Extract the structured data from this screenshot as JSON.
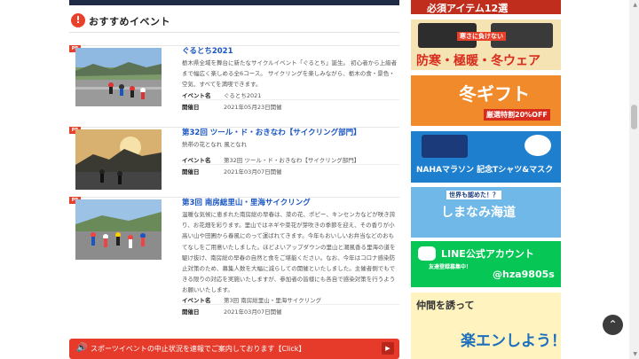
{
  "section": {
    "icon": "!",
    "title": "おすすめイベント"
  },
  "events": [
    {
      "badge": "PR",
      "title": "ぐるとち2021",
      "desc": "栃木県全域を舞台に新たなサイクルイベント「ぐるとち」誕生。 初心者から上級者まで幅広く楽しめる全6コース。 サイクリングを楽しみながら、栃木の食・景色・空気、すべてを満喫できます。",
      "event_label": "イベント名",
      "event_name": "ぐるとち2021",
      "date_label": "開催日",
      "date": "2021年05月23日開催"
    },
    {
      "badge": "PR",
      "title": "第32回 ツール・ド・おきなわ【サイクリング部門】",
      "desc": "熱帯の花となれ 風となれ",
      "event_label": "イベント名",
      "event_name": "第32回 ツール・ド・おきなわ【サイクリング部門】",
      "date_label": "開催日",
      "date": "2021年03月07日開催"
    },
    {
      "badge": "PR",
      "title": "第3回 南房総里山・里海サイクリング",
      "desc": "温暖な気候に恵まれた南房総の早春は、菜の花、ポピー、キンセンカなどが咲き誇り、お花畑を彩ります。里山ではネギや菜花が芽吹きの季節を迎え、その香りが小高い山や田圃から春風にのって運ばれてきます。今年もおいしいお弁当などのおもてなしをご用意いたしました。ほどよいアップダウンの里山と潮風香る里海の道を駆け抜け、南房総の早春の自然と食をご堪能ください。なお、今年はコロナ感染防止対策のため、募集人数を大幅に減らしての開催といたしました。主催者側でもできる限りの対応を実施いたしますが、参加者の皆様にも各自で感染対策を行うようお願いいたします。",
      "event_label": "イベント名",
      "event_name": "第3回 南房総里山・里海サイクリング",
      "date_label": "開催日",
      "date": "2021年03月07日開催"
    }
  ],
  "notice": {
    "text": "スポーツイベントの中止状況を速報でご案内しております【Click】",
    "arrow": "▶"
  },
  "sidebar_banners": [
    {
      "text": "必須アイテム12選"
    },
    {
      "text": "防寒・極暖・冬ウェア",
      "sub": "寒さに負けない"
    },
    {
      "text": "冬ギフト",
      "sub": "厳選特割20%OFF"
    },
    {
      "text": "NAHAマラソン 記念Tシャツ&マスク"
    },
    {
      "text": "しまなみ海道",
      "sub": "世界も認めた！？"
    },
    {
      "text": "LINE公式アカウント",
      "sub": "友達登録募集中！",
      "id": "@hza9805s"
    },
    {
      "text": "楽エンしよう！",
      "sub": "仲間を誘って"
    }
  ],
  "colors": {
    "accent": "#e8402a",
    "link": "#1a56c2",
    "line": "#06c755"
  }
}
